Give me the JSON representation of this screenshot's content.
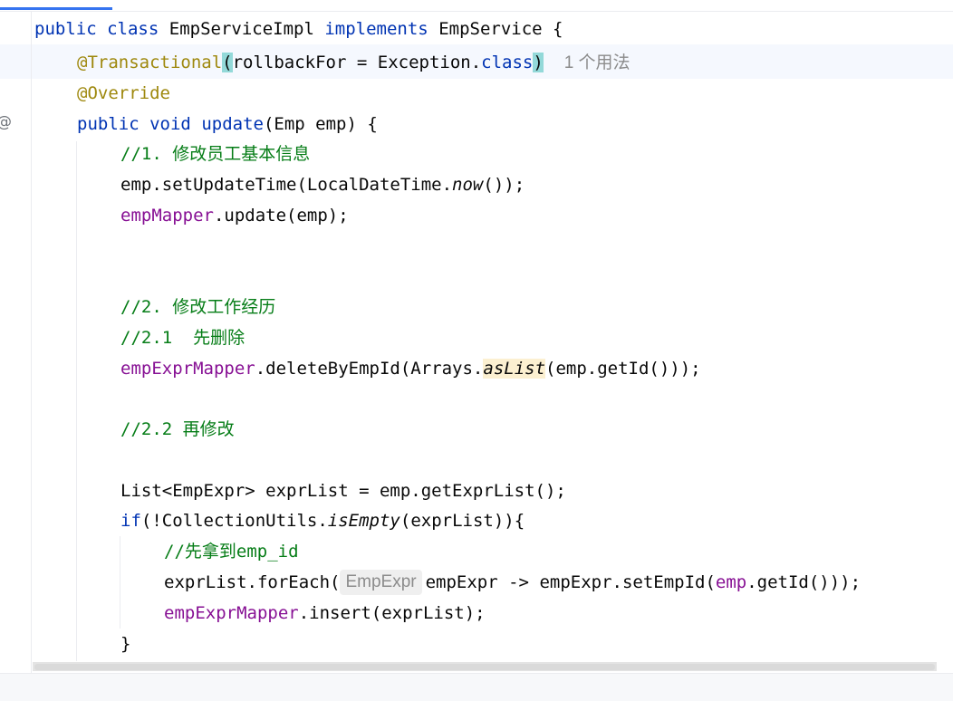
{
  "editor": {
    "line_class": {
      "kw1": "public",
      "kw2": "class",
      "name": "EmpServiceImpl",
      "kw3": "implements",
      "iface": "EmpService",
      "brace": "{"
    },
    "line_transactional": {
      "annotation": "@Transactional",
      "open": "(",
      "args_before": "rollbackFor = Exception.",
      "kw_class": "class",
      "close": ")",
      "usages_hint": "1 个用法"
    },
    "line_override": {
      "annotation": "@Override"
    },
    "line_method": {
      "kw1": "public",
      "kw2": "void",
      "name": "update",
      "params": "(Emp emp) {"
    },
    "comment_1": "//1. 修改员工基本信息",
    "line_set_update_time": {
      "before": "emp.setUpdateTime(LocalDateTime.",
      "method": "now",
      "after": "());"
    },
    "line_mapper_update": {
      "field": "empMapper",
      "rest": ".update(emp);"
    },
    "comment_2": "//2. 修改工作经历",
    "comment_2_1": "//2.1  先删除",
    "line_delete": {
      "field": "empExprMapper",
      "before": ".deleteByEmpId(Arrays.",
      "method": "asList",
      "after": "(emp.getId()));"
    },
    "comment_2_2": "//2.2 再修改",
    "line_list_decl": "List<EmpExpr> exprList = emp.getExprList();",
    "line_if": {
      "kw": "if",
      "before": "(!CollectionUtils.",
      "method": "isEmpty",
      "after": "(exprList)){"
    },
    "comment_inner": "//先拿到emp_id",
    "line_foreach": {
      "before": "exprList.forEach(",
      "type_hint": "EmpExpr",
      "middle": "empExpr -> empExpr.setEmpId(",
      "field": "emp",
      "after": ".getId()));"
    },
    "line_insert": {
      "field": "empExprMapper",
      "rest": ".insert(exprList);"
    },
    "line_close_if": "}"
  },
  "gutter": {
    "override_marker": "@"
  },
  "colors": {
    "keyword": "#0033b3",
    "annotation": "#9e880d",
    "comment": "#067d17",
    "field": "#871094",
    "text": "#080808",
    "hint": "#8c8c8c",
    "accent": "#3574f0"
  }
}
